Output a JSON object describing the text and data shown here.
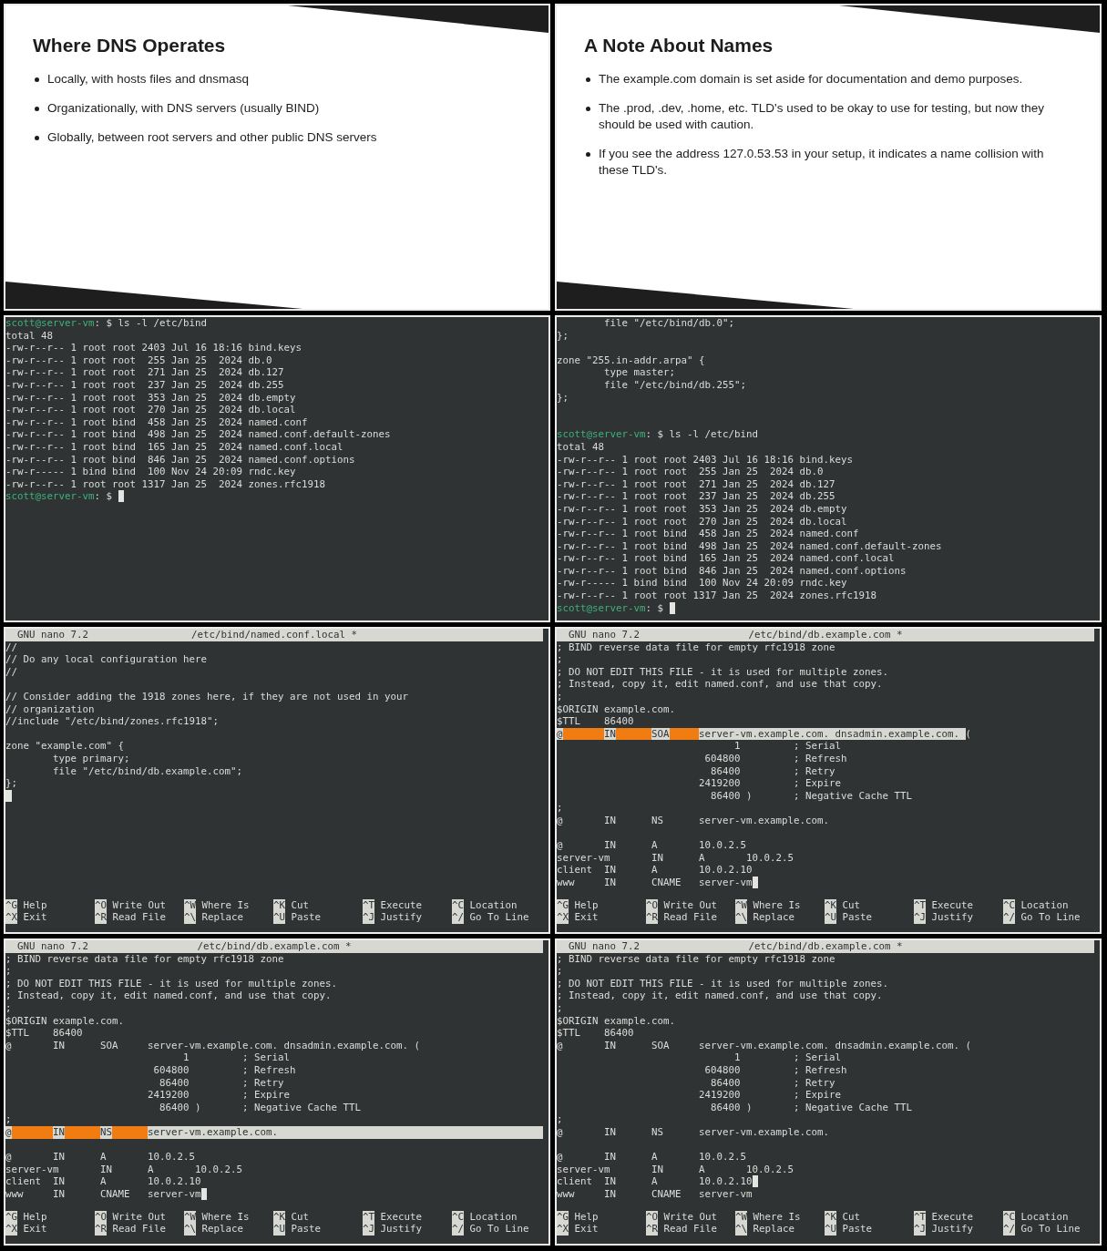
{
  "panels": [
    {
      "kind": "slide",
      "title": "Where DNS Operates",
      "bullets": [
        "Locally, with hosts files and dnsmasq",
        "Organizationally, with DNS servers (usually BIND)",
        "Globally, between root servers and other public DNS servers"
      ]
    },
    {
      "kind": "slide",
      "title": "A Note About Names",
      "bullets": [
        "The example.com domain is set aside for documentation and demo purposes.",
        "The .prod, .dev, .home, etc. TLD's used to be okay to use for testing, but now they should be used with caution.",
        "If you see the address 127.0.53.53 in your setup, it indicates a name collision with these TLD's."
      ]
    },
    {
      "kind": "terminal",
      "lines": [
        {
          "kind": "prompt",
          "user": "scott@server-vm",
          "prompt": ": $",
          "command": "ls -l /etc/bind",
          "cursor": false
        },
        {
          "kind": "text",
          "text": "total 48",
          "cursor": false
        },
        {
          "kind": "text",
          "text": "-rw-r--r-- 1 root root 2403 Jul 16 18:16 bind.keys",
          "cursor": false
        },
        {
          "kind": "text",
          "text": "-rw-r--r-- 1 root root  255 Jan 25  2024 db.0",
          "cursor": false
        },
        {
          "kind": "text",
          "text": "-rw-r--r-- 1 root root  271 Jan 25  2024 db.127",
          "cursor": false
        },
        {
          "kind": "text",
          "text": "-rw-r--r-- 1 root root  237 Jan 25  2024 db.255",
          "cursor": false
        },
        {
          "kind": "text",
          "text": "-rw-r--r-- 1 root root  353 Jan 25  2024 db.empty",
          "cursor": false
        },
        {
          "kind": "text",
          "text": "-rw-r--r-- 1 root root  270 Jan 25  2024 db.local",
          "cursor": false
        },
        {
          "kind": "text",
          "text": "-rw-r--r-- 1 root bind  458 Jan 25  2024 named.conf",
          "cursor": false
        },
        {
          "kind": "text",
          "text": "-rw-r--r-- 1 root bind  498 Jan 25  2024 named.conf.default-zones",
          "cursor": false
        },
        {
          "kind": "text",
          "text": "-rw-r--r-- 1 root bind  165 Jan 25  2024 named.conf.local",
          "cursor": false
        },
        {
          "kind": "text",
          "text": "-rw-r--r-- 1 root bind  846 Jan 25  2024 named.conf.options",
          "cursor": false
        },
        {
          "kind": "text",
          "text": "-rw-r----- 1 bind bind  100 Nov 24 20:09 rndc.key",
          "cursor": false
        },
        {
          "kind": "text",
          "text": "-rw-r--r-- 1 root root 1317 Jan 25  2024 zones.rfc1918",
          "cursor": false
        },
        {
          "kind": "prompt",
          "user": "scott@server-vm",
          "prompt": ": $",
          "cursor": true
        }
      ]
    },
    {
      "kind": "terminal",
      "lines": [
        {
          "kind": "text",
          "text": "        file \"/etc/bind/db.0\";",
          "cursor": false
        },
        {
          "kind": "text",
          "text": "};",
          "cursor": false
        },
        {
          "kind": "blank",
          "cursor": false
        },
        {
          "kind": "text",
          "text": "zone \"255.in-addr.arpa\" {",
          "cursor": false
        },
        {
          "kind": "text",
          "text": "        type master;",
          "cursor": false
        },
        {
          "kind": "text",
          "text": "        file \"/etc/bind/db.255\";",
          "cursor": false
        },
        {
          "kind": "text",
          "text": "};",
          "cursor": false
        },
        {
          "kind": "blank",
          "cursor": false
        },
        {
          "kind": "blank",
          "cursor": false
        },
        {
          "kind": "prompt",
          "user": "scott@server-vm",
          "prompt": ": $",
          "command": "ls -l /etc/bind",
          "cursor": false
        },
        {
          "kind": "text",
          "text": "total 48",
          "cursor": false
        },
        {
          "kind": "text",
          "text": "-rw-r--r-- 1 root root 2403 Jul 16 18:16 bind.keys",
          "cursor": false
        },
        {
          "kind": "text",
          "text": "-rw-r--r-- 1 root root  255 Jan 25  2024 db.0",
          "cursor": false
        },
        {
          "kind": "text",
          "text": "-rw-r--r-- 1 root root  271 Jan 25  2024 db.127",
          "cursor": false
        },
        {
          "kind": "text",
          "text": "-rw-r--r-- 1 root root  237 Jan 25  2024 db.255",
          "cursor": false
        },
        {
          "kind": "text",
          "text": "-rw-r--r-- 1 root root  353 Jan 25  2024 db.empty",
          "cursor": false
        },
        {
          "kind": "text",
          "text": "-rw-r--r-- 1 root root  270 Jan 25  2024 db.local",
          "cursor": false
        },
        {
          "kind": "text",
          "text": "-rw-r--r-- 1 root bind  458 Jan 25  2024 named.conf",
          "cursor": false
        },
        {
          "kind": "text",
          "text": "-rw-r--r-- 1 root bind  498 Jan 25  2024 named.conf.default-zones",
          "cursor": false
        },
        {
          "kind": "text",
          "text": "-rw-r--r-- 1 root bind  165 Jan 25  2024 named.conf.local",
          "cursor": false
        },
        {
          "kind": "text",
          "text": "-rw-r--r-- 1 root bind  846 Jan 25  2024 named.conf.options",
          "cursor": false
        },
        {
          "kind": "text",
          "text": "-rw-r----- 1 bind bind  100 Nov 24 20:09 rndc.key",
          "cursor": false
        },
        {
          "kind": "text",
          "text": "-rw-r--r-- 1 root root 1317 Jan 25  2024 zones.rfc1918",
          "cursor": false
        },
        {
          "kind": "prompt",
          "user": "scott@server-vm",
          "prompt": ": $",
          "cursor": true
        }
      ]
    },
    {
      "kind": "nano",
      "app": "GNU nano 7.2",
      "file": "/etc/bind/named.conf.local *",
      "lines": [
        {
          "kind": "text",
          "text": "//",
          "cursor": false
        },
        {
          "kind": "text",
          "text": "// Do any local configuration here",
          "cursor": false
        },
        {
          "kind": "text",
          "text": "//",
          "cursor": false
        },
        {
          "kind": "blank",
          "cursor": false
        },
        {
          "kind": "text",
          "text": "// Consider adding the 1918 zones here, if they are not used in your",
          "cursor": false
        },
        {
          "kind": "text",
          "text": "// organization",
          "cursor": false
        },
        {
          "kind": "text",
          "text": "//include \"/etc/bind/zones.rfc1918\";",
          "cursor": false
        },
        {
          "kind": "blank",
          "cursor": false
        },
        {
          "kind": "text",
          "text": "zone \"example.com\" {",
          "cursor": false
        },
        {
          "kind": "text",
          "text": "\ttype primary;",
          "cursor": false
        },
        {
          "kind": "text",
          "text": "\tfile \"/etc/bind/db.example.com\";",
          "cursor": false
        },
        {
          "kind": "text",
          "text": "};",
          "cursor": false
        },
        {
          "kind": "blank",
          "cursor": true
        }
      ],
      "shortcuts": [
        {
          "key": "^G",
          "label": "Help"
        },
        {
          "key": "^O",
          "label": "Write Out"
        },
        {
          "key": "^W",
          "label": "Where Is"
        },
        {
          "key": "^K",
          "label": "Cut"
        },
        {
          "key": "^T",
          "label": "Execute"
        },
        {
          "key": "^C",
          "label": "Location"
        },
        {
          "key": "^X",
          "label": "Exit"
        },
        {
          "key": "^R",
          "label": "Read File"
        },
        {
          "key": "^\\",
          "label": "Replace"
        },
        {
          "key": "^U",
          "label": "Paste"
        },
        {
          "key": "^J",
          "label": "Justify"
        },
        {
          "key": "^/",
          "label": "Go To Line"
        }
      ]
    },
    {
      "kind": "nano",
      "app": "GNU nano 7.2",
      "file": "/etc/bind/db.example.com *",
      "lines": [
        {
          "kind": "text",
          "text": "; BIND reverse data file for empty rfc1918 zone",
          "cursor": false
        },
        {
          "kind": "text",
          "text": ";",
          "cursor": false
        },
        {
          "kind": "text",
          "text": "; DO NOT EDIT THIS FILE - it is used for multiple zones.",
          "cursor": false
        },
        {
          "kind": "text",
          "text": "; Instead, copy it, edit named.conf, and use that copy.",
          "cursor": false
        },
        {
          "kind": "text",
          "text": ";",
          "cursor": false
        },
        {
          "kind": "text",
          "text": "$ORIGIN example.com.",
          "cursor": false
        },
        {
          "kind": "text",
          "text": "$TTL\t86400",
          "cursor": false
        },
        {
          "kind": "marked",
          "fields": [
            "@",
            "IN",
            "SOA",
            "server-vm.example.com. dnsadmin.example.com. "
          ],
          "rest": "(",
          "to_end": false,
          "cursor": false
        },
        {
          "kind": "text",
          "text": "\t\t\t      1\t\t; Serial",
          "cursor": false
        },
        {
          "kind": "text",
          "text": "\t\t\t 604800\t\t; Refresh",
          "cursor": false
        },
        {
          "kind": "text",
          "text": "\t\t\t  86400\t\t; Retry",
          "cursor": false
        },
        {
          "kind": "text",
          "text": "\t\t\t2419200\t\t; Expire",
          "cursor": false
        },
        {
          "kind": "text",
          "text": "\t\t\t  86400 )\t; Negative Cache TTL",
          "cursor": false
        },
        {
          "kind": "text",
          "text": ";",
          "cursor": false
        },
        {
          "kind": "text",
          "text": "@\tIN\tNS\tserver-vm.example.com.",
          "cursor": false
        },
        {
          "kind": "blank",
          "cursor": false
        },
        {
          "kind": "text",
          "text": "@\tIN\tA\t10.0.2.5",
          "cursor": false
        },
        {
          "kind": "text",
          "text": "server-vm\tIN\tA\t10.0.2.5",
          "cursor": false
        },
        {
          "kind": "text",
          "text": "client\tIN\tA\t10.0.2.10",
          "cursor": false
        },
        {
          "kind": "text",
          "text": "www\tIN\tCNAME\tserver-vm",
          "cursor": true
        }
      ],
      "shortcuts": [
        {
          "key": "^G",
          "label": "Help"
        },
        {
          "key": "^O",
          "label": "Write Out"
        },
        {
          "key": "^W",
          "label": "Where Is"
        },
        {
          "key": "^K",
          "label": "Cut"
        },
        {
          "key": "^T",
          "label": "Execute"
        },
        {
          "key": "^C",
          "label": "Location"
        },
        {
          "key": "^X",
          "label": "Exit"
        },
        {
          "key": "^R",
          "label": "Read File"
        },
        {
          "key": "^\\",
          "label": "Replace"
        },
        {
          "key": "^U",
          "label": "Paste"
        },
        {
          "key": "^J",
          "label": "Justify"
        },
        {
          "key": "^/",
          "label": "Go To Line"
        }
      ]
    },
    {
      "kind": "nano",
      "app": "GNU nano 7.2",
      "file": "/etc/bind/db.example.com *",
      "lines": [
        {
          "kind": "text",
          "text": "; BIND reverse data file for empty rfc1918 zone",
          "cursor": false
        },
        {
          "kind": "text",
          "text": ";",
          "cursor": false
        },
        {
          "kind": "text",
          "text": "; DO NOT EDIT THIS FILE - it is used for multiple zones.",
          "cursor": false
        },
        {
          "kind": "text",
          "text": "; Instead, copy it, edit named.conf, and use that copy.",
          "cursor": false
        },
        {
          "kind": "text",
          "text": ";",
          "cursor": false
        },
        {
          "kind": "text",
          "text": "$ORIGIN example.com.",
          "cursor": false
        },
        {
          "kind": "text",
          "text": "$TTL\t86400",
          "cursor": false
        },
        {
          "kind": "text",
          "text": "@\tIN\tSOA\tserver-vm.example.com. dnsadmin.example.com. (",
          "cursor": false
        },
        {
          "kind": "text",
          "text": "\t\t\t      1\t\t; Serial",
          "cursor": false
        },
        {
          "kind": "text",
          "text": "\t\t\t 604800\t\t; Refresh",
          "cursor": false
        },
        {
          "kind": "text",
          "text": "\t\t\t  86400\t\t; Retry",
          "cursor": false
        },
        {
          "kind": "text",
          "text": "\t\t\t2419200\t\t; Expire",
          "cursor": false
        },
        {
          "kind": "text",
          "text": "\t\t\t  86400 )\t; Negative Cache TTL",
          "cursor": false
        },
        {
          "kind": "text",
          "text": ";",
          "cursor": false
        },
        {
          "kind": "marked",
          "fields": [
            "@",
            "IN",
            "NS",
            "server-vm.example.com."
          ],
          "to_end": true,
          "cursor": false
        },
        {
          "kind": "blank",
          "cursor": false
        },
        {
          "kind": "text",
          "text": "@\tIN\tA\t10.0.2.5",
          "cursor": false
        },
        {
          "kind": "text",
          "text": "server-vm\tIN\tA\t10.0.2.5",
          "cursor": false
        },
        {
          "kind": "text",
          "text": "client\tIN\tA\t10.0.2.10",
          "cursor": false
        },
        {
          "kind": "text",
          "text": "www\tIN\tCNAME\tserver-vm",
          "cursor": true
        }
      ],
      "shortcuts": [
        {
          "key": "^G",
          "label": "Help"
        },
        {
          "key": "^O",
          "label": "Write Out"
        },
        {
          "key": "^W",
          "label": "Where Is"
        },
        {
          "key": "^K",
          "label": "Cut"
        },
        {
          "key": "^T",
          "label": "Execute"
        },
        {
          "key": "^C",
          "label": "Location"
        },
        {
          "key": "^X",
          "label": "Exit"
        },
        {
          "key": "^R",
          "label": "Read File"
        },
        {
          "key": "^\\",
          "label": "Replace"
        },
        {
          "key": "^U",
          "label": "Paste"
        },
        {
          "key": "^J",
          "label": "Justify"
        },
        {
          "key": "^/",
          "label": "Go To Line"
        }
      ]
    },
    {
      "kind": "nano",
      "app": "GNU nano 7.2",
      "file": "/etc/bind/db.example.com *",
      "lines": [
        {
          "kind": "text",
          "text": "; BIND reverse data file for empty rfc1918 zone",
          "cursor": false
        },
        {
          "kind": "text",
          "text": ";",
          "cursor": false
        },
        {
          "kind": "text",
          "text": "; DO NOT EDIT THIS FILE - it is used for multiple zones.",
          "cursor": false
        },
        {
          "kind": "text",
          "text": "; Instead, copy it, edit named.conf, and use that copy.",
          "cursor": false
        },
        {
          "kind": "text",
          "text": ";",
          "cursor": false
        },
        {
          "kind": "text",
          "text": "$ORIGIN example.com.",
          "cursor": false
        },
        {
          "kind": "text",
          "text": "$TTL\t86400",
          "cursor": false
        },
        {
          "kind": "text",
          "text": "@\tIN\tSOA\tserver-vm.example.com. dnsadmin.example.com. (",
          "cursor": false
        },
        {
          "kind": "text",
          "text": "\t\t\t      1\t\t; Serial",
          "cursor": false
        },
        {
          "kind": "text",
          "text": "\t\t\t 604800\t\t; Refresh",
          "cursor": false
        },
        {
          "kind": "text",
          "text": "\t\t\t  86400\t\t; Retry",
          "cursor": false
        },
        {
          "kind": "text",
          "text": "\t\t\t2419200\t\t; Expire",
          "cursor": false
        },
        {
          "kind": "text",
          "text": "\t\t\t  86400 )\t; Negative Cache TTL",
          "cursor": false
        },
        {
          "kind": "text",
          "text": ";",
          "cursor": false
        },
        {
          "kind": "text",
          "text": "@\tIN\tNS\tserver-vm.example.com.",
          "cursor": false
        },
        {
          "kind": "blank",
          "cursor": false
        },
        {
          "kind": "text",
          "text": "@\tIN\tA\t10.0.2.5",
          "cursor": false
        },
        {
          "kind": "text",
          "text": "server-vm\tIN\tA\t10.0.2.5",
          "cursor": false
        },
        {
          "kind": "text",
          "text": "client\tIN\tA\t10.0.2.10",
          "cursor": true
        },
        {
          "kind": "text",
          "text": "www\tIN\tCNAME\tserver-vm",
          "cursor": false
        }
      ],
      "shortcuts": [
        {
          "key": "^G",
          "label": "Help"
        },
        {
          "key": "^O",
          "label": "Write Out"
        },
        {
          "key": "^W",
          "label": "Where Is"
        },
        {
          "key": "^K",
          "label": "Cut"
        },
        {
          "key": "^T",
          "label": "Execute"
        },
        {
          "key": "^C",
          "label": "Location"
        },
        {
          "key": "^X",
          "label": "Exit"
        },
        {
          "key": "^R",
          "label": "Read File"
        },
        {
          "key": "^\\",
          "label": "Replace"
        },
        {
          "key": "^U",
          "label": "Paste"
        },
        {
          "key": "^J",
          "label": "Justify"
        },
        {
          "key": "^/",
          "label": "Go To Line"
        }
      ]
    }
  ]
}
